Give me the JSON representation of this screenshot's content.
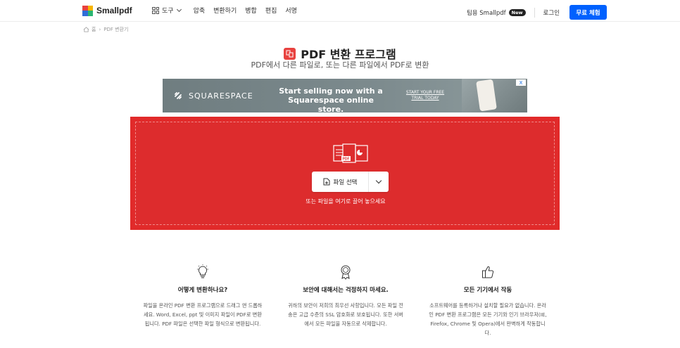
{
  "header": {
    "logo_text": "Smallpdf",
    "tools_label": "도구",
    "nav_items": [
      "압축",
      "변환하기",
      "병합",
      "편집",
      "서명"
    ],
    "team_label": "팀용 Smallpdf",
    "new_badge": "New",
    "login_label": "로그인",
    "trial_label": "무료 체험",
    "trial_color": "#0061fe"
  },
  "breadcrumb": {
    "home": "홈",
    "separator": "›",
    "current": "PDF 변환기"
  },
  "page": {
    "title": "PDF 변환 프로그램",
    "subtitle": "PDF에서 다른 파일로, 또는 다른 파일에서 PDF로 변환",
    "accent_color": "#e12a2a"
  },
  "ad": {
    "brand": "SQUARESPACE",
    "headline": "Start selling now with a Squarespace online store.",
    "cta": "START YOUR FREE TRIAL TODAY",
    "close_label": "X"
  },
  "dropzone": {
    "file_label": "PDF",
    "choose_label": "파일 선택",
    "hint": "또는 파일을 여기로 끌어 놓으세요"
  },
  "features": [
    {
      "icon": "lightbulb-icon",
      "title": "어떻게 변환하나요?",
      "description": "파일을 온라인 PDF 변환 프로그램으로 드래그 앤 드롭하세요. Word, Excel, ppt 및 이미지 파일이 PDF로 변환됩니다. PDF 파일은 선택한 파일 형식으로 변환됩니다."
    },
    {
      "icon": "award-badge-icon",
      "title": "보안에 대해서는 걱정하지 마세요.",
      "description": "귀하의 보안이 저희의 최우선 사항입니다. 모든 파일 전송은 고급 수준의 SSL 암호화로 보호됩니다. 또한 서버에서 모든 파일을 자동으로 삭제합니다."
    },
    {
      "icon": "thumbs-up-icon",
      "title": "모든 기기에서 작동",
      "description": "소프트웨어를 등록하거나 설치할 필요가 없습니다. 온라인 PDF 변환 프로그램은 모든 기기와 인기 브라우저(IE, Firefox, Chrome 및 Opera)에서 완벽하게 작동합니다."
    }
  ]
}
